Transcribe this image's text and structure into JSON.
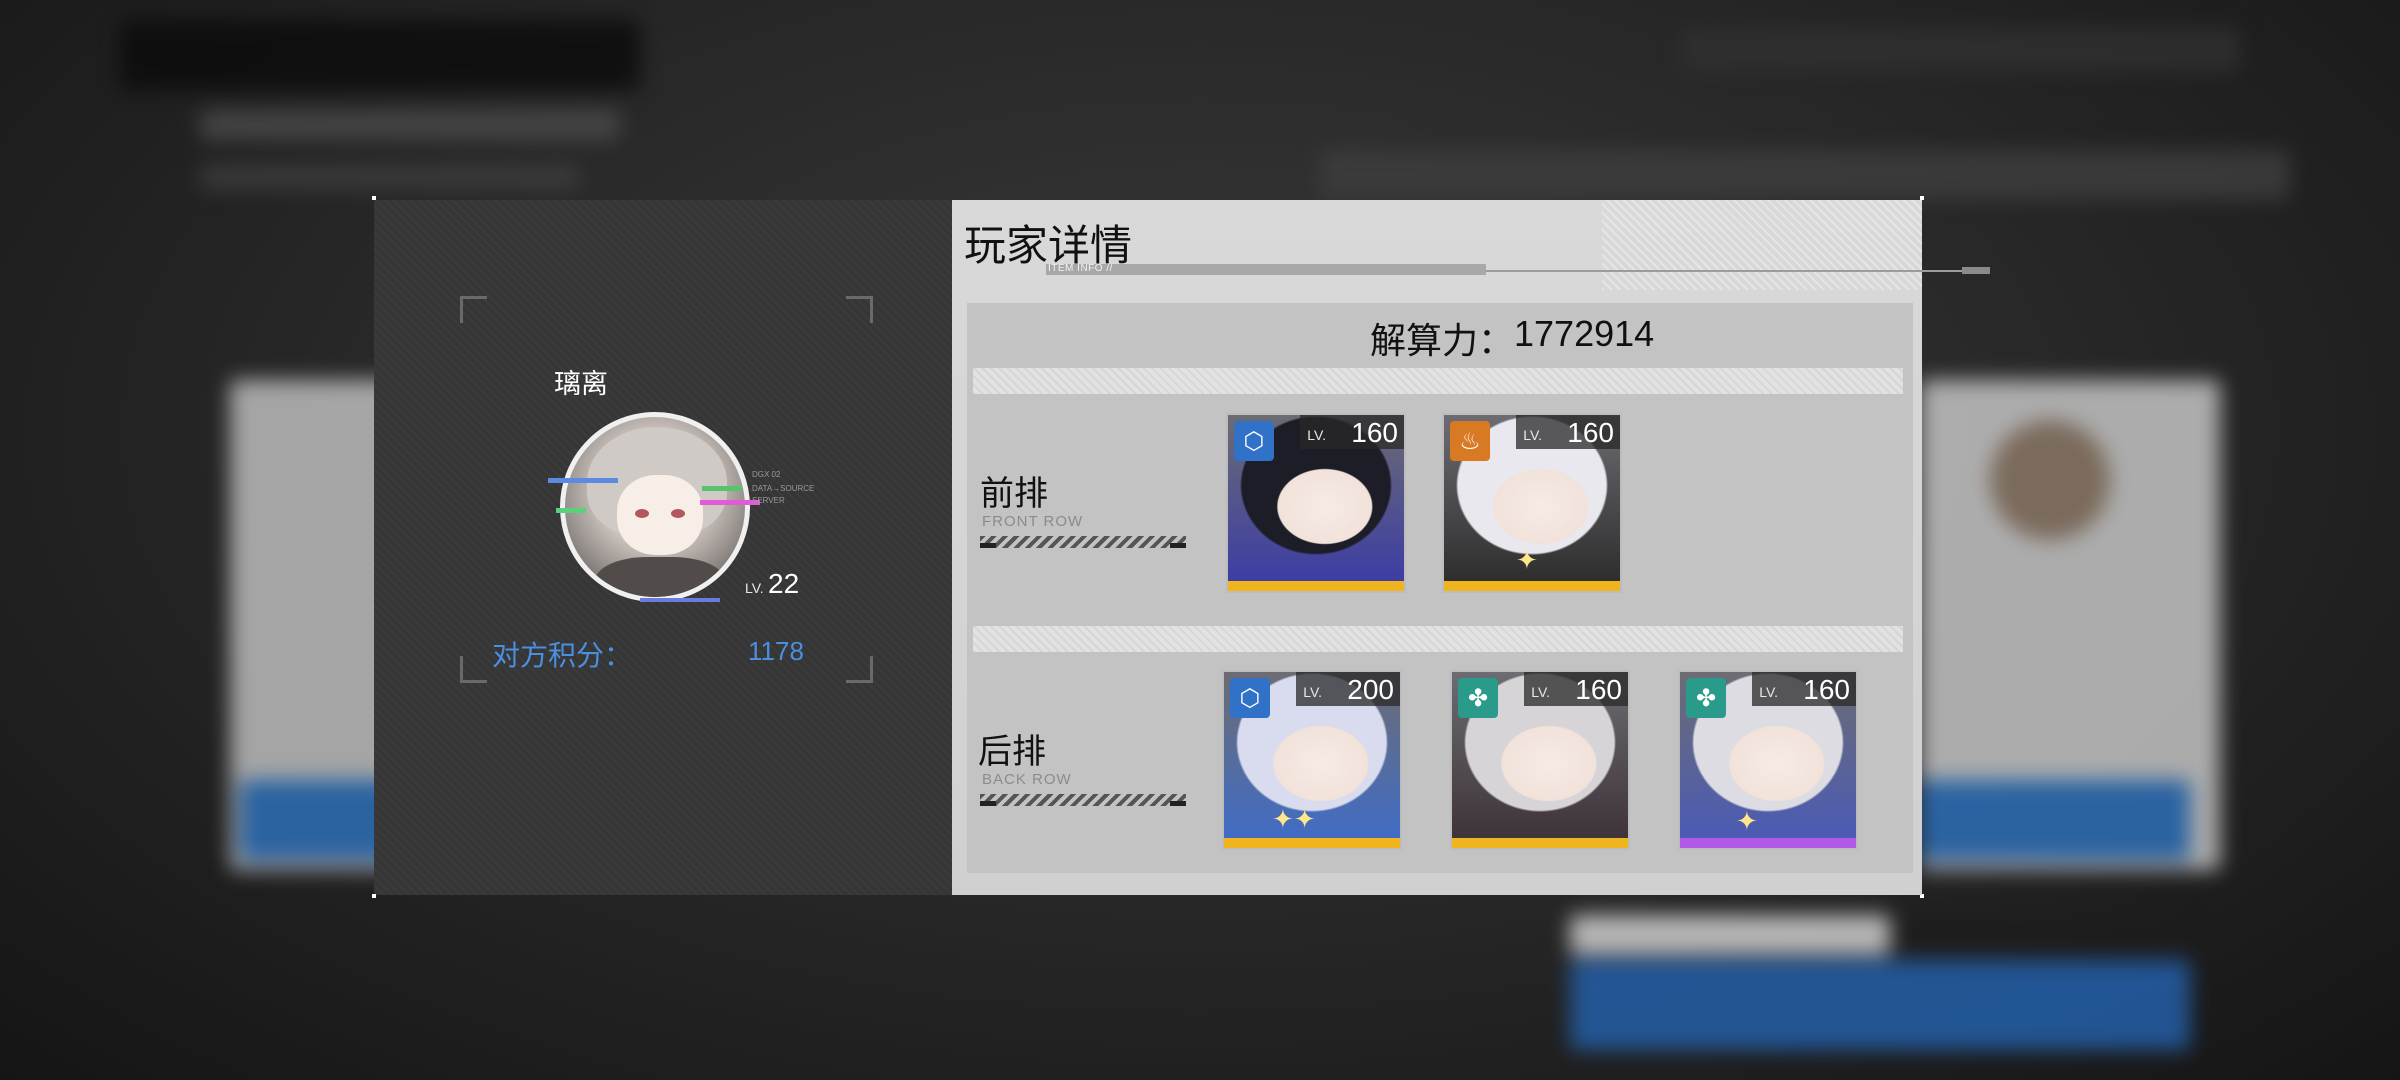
{
  "dialog": {
    "title": "玩家详情",
    "subtitle": "ITEM INFO //",
    "player": {
      "name": "璃离",
      "level_prefix": "LV.",
      "level": "22",
      "score_label": "对方积分：",
      "score_value": "1178",
      "avatar_tags": [
        "DGX 02",
        "DATA→SOURCE",
        "SERVER"
      ]
    },
    "power_label": "解算力：",
    "power_value": "1772914",
    "front_row": {
      "label": "前排",
      "label_en": "FRONT ROW",
      "characters": [
        {
          "element_icon": "blue-hex-icon",
          "level": "160",
          "rarity_color": "#f0b41e",
          "hair": "#1d1d28",
          "accent": "#3a3aa8"
        },
        {
          "element_icon": "orange-flame-icon",
          "level": "160",
          "rarity_color": "#f0b41e",
          "hair": "#e8e8ee",
          "accent": "#2a2a2a"
        }
      ]
    },
    "back_row": {
      "label": "后排",
      "label_en": "BACK ROW",
      "characters": [
        {
          "element_icon": "blue-hex-icon",
          "level": "200",
          "rarity_color": "#f0b41e",
          "hair": "#d8dcee",
          "accent": "#3f6cc9"
        },
        {
          "element_icon": "teal-clover-icon",
          "level": "160",
          "rarity_color": "#f0b41e",
          "hair": "#d7d4d8",
          "accent": "#3b3036"
        },
        {
          "element_icon": "teal-clover-icon",
          "level": "160",
          "rarity_color": "#b05ae6",
          "hair": "#dcdce2",
          "accent": "#4a5ab8"
        }
      ]
    },
    "level_prefix": "LV.",
    "colors": {
      "score_blue": "#4b8fe0",
      "elem_blue": "#2f72c8",
      "elem_orange": "#d87a24",
      "elem_teal": "#2a9a8a",
      "rarity_gold": "#f0b41e",
      "rarity_purple": "#b05ae6"
    }
  }
}
